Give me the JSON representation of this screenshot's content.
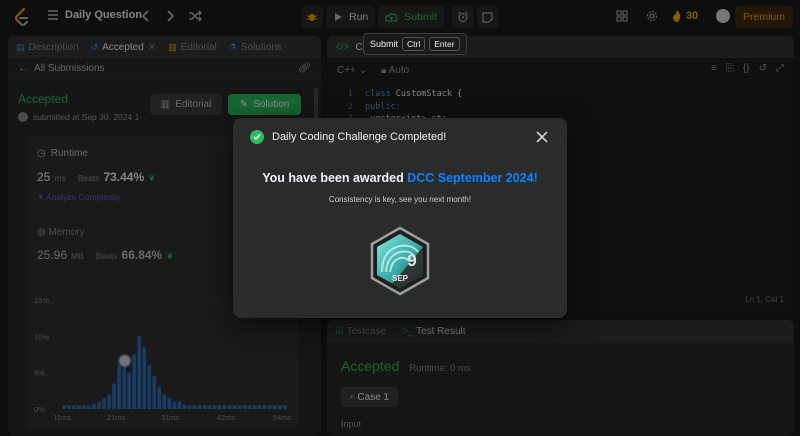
{
  "topbar": {
    "daily_question": "Daily Question",
    "run_label": "Run",
    "submit_label": "Submit",
    "streak_count": "30",
    "premium_label": "Premium"
  },
  "tooltip": {
    "label": "Submit",
    "key1": "Ctrl",
    "key2": "Enter"
  },
  "left_panel": {
    "tabs": [
      "Description",
      "Accepted",
      "Editorial",
      "Solutions"
    ],
    "all_submissions": "All Submissions",
    "status": "Accepted",
    "submitted_text": "submitted at Sep 30, 2024 1",
    "editorial_btn": "Editorial",
    "solution_btn": "Solution",
    "runtime_label": "Runtime",
    "runtime_value": "25",
    "runtime_unit": "ms",
    "beats_label": "Beats",
    "runtime_beats": "73.44%",
    "analyze_label": "Analyze Complexity",
    "memory_label": "Memory",
    "memory_value": "25.96",
    "memory_unit": "MB",
    "memory_beats": "66.84%"
  },
  "chart_data": {
    "type": "bar",
    "y_ticks": [
      "15%",
      "10%",
      "5%",
      "0%"
    ],
    "x_ticks": [
      "11ms",
      "21ms",
      "31ms",
      "42ms",
      "54ms"
    ],
    "ylim": [
      0,
      15
    ],
    "values": [
      0.5,
      0.5,
      0.5,
      0.5,
      0.5,
      0.5,
      0.7,
      1,
      1.5,
      2,
      3.5,
      6,
      6.5,
      5,
      7.5,
      10,
      8.5,
      6,
      4.5,
      3,
      2,
      1.5,
      1,
      1,
      0.6,
      0.5,
      0.5,
      0.5,
      0.5,
      0.5,
      0.5,
      0.5,
      0.5,
      0.5,
      0.5,
      0.5,
      0.5,
      0.5,
      0.5,
      0.5,
      0.5,
      0.5,
      0.5,
      0.5,
      0.5
    ],
    "bar_color": "#2d6eb7"
  },
  "code_panel": {
    "tab_label": "Code",
    "language": "C++",
    "mode": "Auto",
    "lines": [
      {
        "n": "1",
        "kw": "class",
        "rest": " CustomStack {"
      },
      {
        "n": "2",
        "kw": "public:",
        "rest": ""
      },
      {
        "n": "3",
        "kw": "",
        "rest": "    vector<int> st;"
      }
    ],
    "cursor_pos": "Ln 1, Col 1"
  },
  "test_panel": {
    "testcase_tab": "Testcase",
    "result_tab": "Test Result",
    "status": "Accepted",
    "runtime": "Runtime: 0 ms",
    "case_label": "Case 1",
    "input_label": "Input"
  },
  "modal": {
    "header": "Daily Coding Challenge Completed!",
    "title_prefix": "You have been awarded ",
    "title_highlight": "DCC September 2024!",
    "subtitle": "Consistency is key, see you next month!",
    "badge_month": "SEP",
    "badge_number": "9"
  },
  "colors": {
    "accent_green": "#2cbb5d",
    "link_blue": "#0a84ff",
    "premium_gold": "#f2a900"
  }
}
